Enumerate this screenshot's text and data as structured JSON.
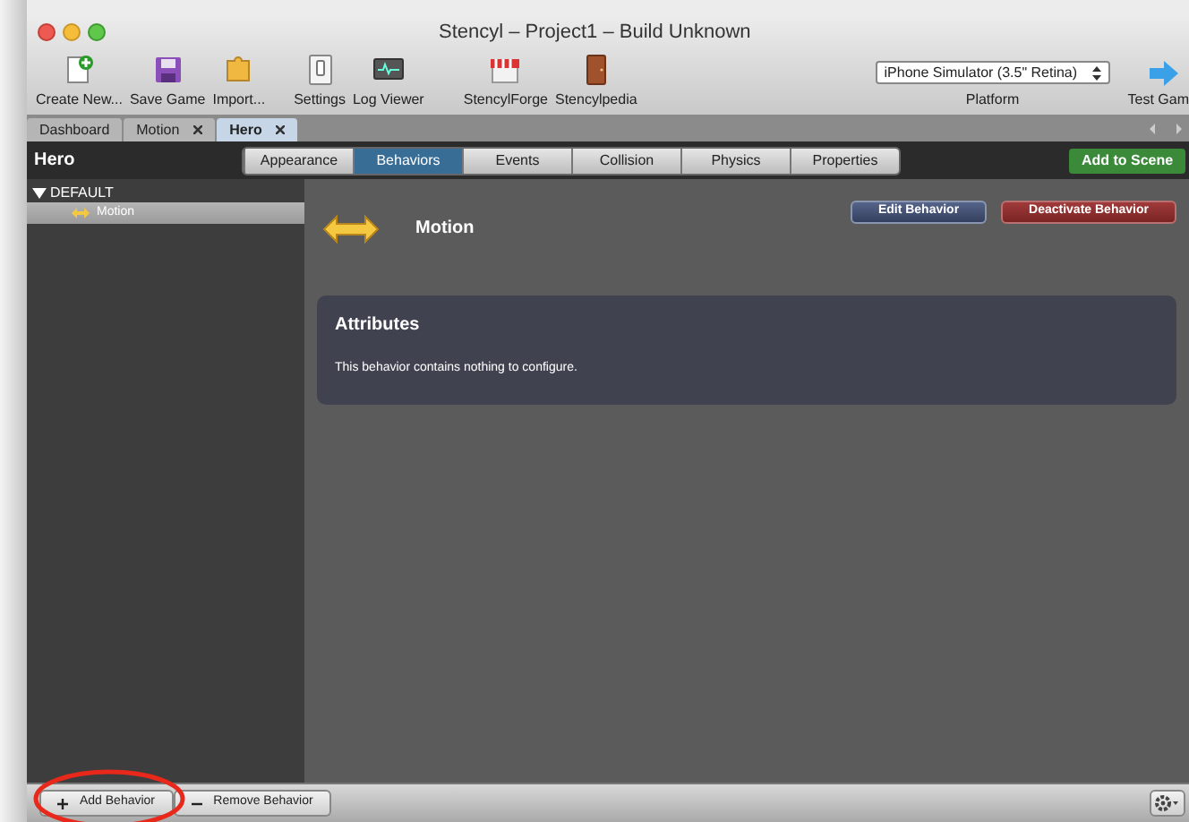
{
  "window": {
    "title": "Stencyl – Project1 – Build Unknown"
  },
  "toolbar": {
    "items": [
      {
        "label": "Create New...",
        "kind": "new"
      },
      {
        "label": "Save Game",
        "kind": "save"
      },
      {
        "label": "Import...",
        "kind": "import"
      },
      {
        "label": "Settings",
        "kind": "settings"
      },
      {
        "label": "Log Viewer",
        "kind": "log"
      },
      {
        "label": "StencylForge",
        "kind": "forge"
      },
      {
        "label": "Stencylpedia",
        "kind": "pedia"
      }
    ],
    "platform": {
      "value": "iPhone Simulator (3.5\" Retina)",
      "label": "Platform"
    },
    "test": {
      "label": "Test Gam"
    }
  },
  "tabs": [
    {
      "label": "Dashboard",
      "selected": false,
      "closable": false
    },
    {
      "label": "Motion",
      "selected": false,
      "closable": true
    },
    {
      "label": "Hero",
      "selected": true,
      "closable": true
    }
  ],
  "editor": {
    "title": "Hero",
    "sections": [
      {
        "label": "Appearance",
        "selected": false
      },
      {
        "label": "Behaviors",
        "selected": true
      },
      {
        "label": "Events",
        "selected": false
      },
      {
        "label": "Collision",
        "selected": false
      },
      {
        "label": "Physics",
        "selected": false
      },
      {
        "label": "Properties",
        "selected": false
      }
    ],
    "add_button": "Add to Scene"
  },
  "sidebar": {
    "groups": [
      {
        "label": "DEFAULT",
        "expanded": true,
        "children": [
          {
            "label": "Motion",
            "selected": true
          }
        ]
      }
    ]
  },
  "behavior": {
    "name": "Motion",
    "edit_button": "Edit Behavior",
    "deactivate_button": "Deactivate Behavior",
    "attributes": {
      "title": "Attributes",
      "message": "This behavior contains nothing to configure."
    }
  },
  "bottom_bar": {
    "add_button": "Add Behavior",
    "remove_button": "Remove Behavior"
  }
}
